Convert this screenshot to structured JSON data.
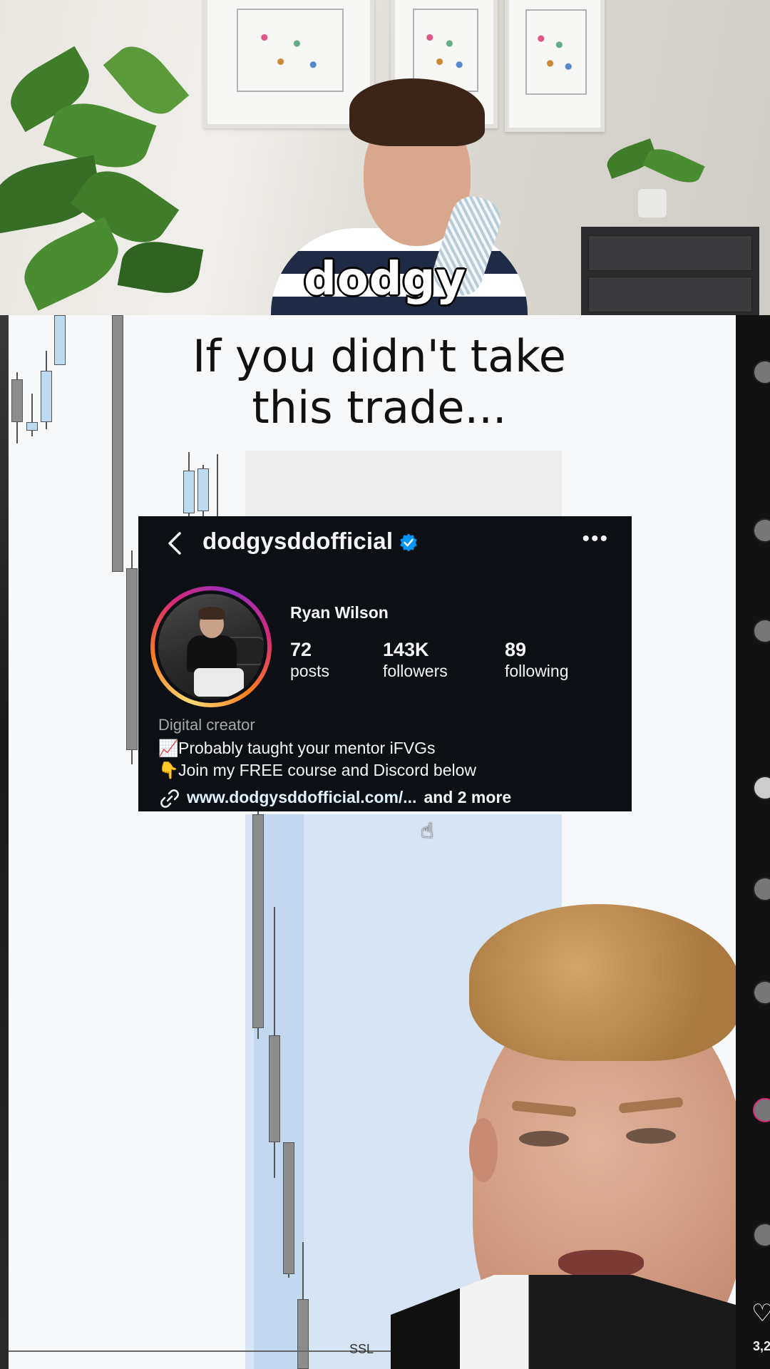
{
  "top_video": {
    "caption_word": "dodgy"
  },
  "screen": {
    "headline_line1": "If you didn't take",
    "headline_line2": "this trade...",
    "level_label": "SSL"
  },
  "profile_card": {
    "username": "dodgysddofficial",
    "verified": true,
    "display_name": "Ryan Wilson",
    "stats": [
      {
        "value": "72",
        "label": "posts"
      },
      {
        "value": "143K",
        "label": "followers"
      },
      {
        "value": "89",
        "label": "following"
      }
    ],
    "category": "Digital creator",
    "bio_line1_emoji": "📈",
    "bio_line1": "Probably taught your mentor iFVGs",
    "bio_line2_emoji": "👇",
    "bio_line2": "Join my FREE course and Discord below",
    "link": "www.dodgysddofficial.com/...",
    "link_more": "and 2 more",
    "icons": {
      "back": "chevron-left-icon",
      "more": "more-options-icon",
      "verified": "verified-badge-icon",
      "link": "link-chain-icon"
    },
    "colors": {
      "background": "#0c1014",
      "verified_blue": "#0095f6",
      "ring_start": "#feda75",
      "ring_end": "#d62976"
    }
  },
  "side_rail": {
    "like_count": "3,2"
  }
}
